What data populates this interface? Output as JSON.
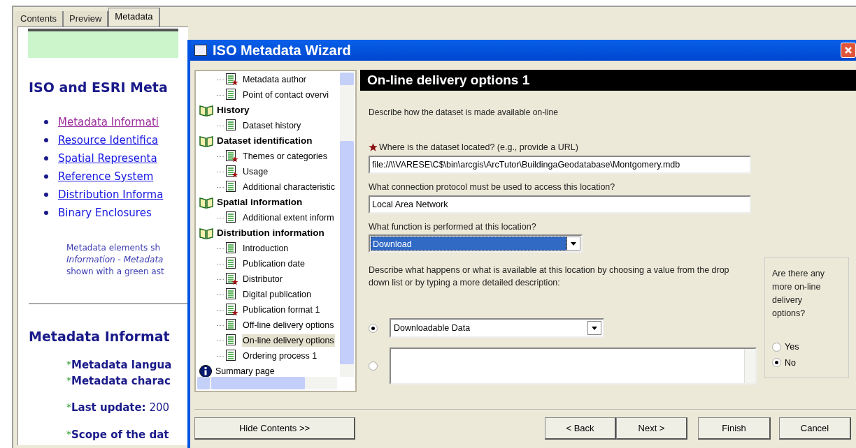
{
  "tabs": [
    {
      "label": "Contents",
      "selected": false
    },
    {
      "label": "Preview",
      "selected": false
    },
    {
      "label": "Metadata",
      "selected": true
    }
  ],
  "page": {
    "heading": "ISO and ESRI Meta",
    "links": [
      {
        "label": "Metadata Informati",
        "visited": true,
        "kind": "link"
      },
      {
        "label": "Resource Identifica",
        "visited": false,
        "kind": "link"
      },
      {
        "label": "Spatial Representa",
        "visited": false,
        "kind": "link"
      },
      {
        "label": "Reference System",
        "visited": false,
        "kind": "link"
      },
      {
        "label": "Distribution Informa",
        "visited": false,
        "kind": "link"
      },
      {
        "label": "Binary Enclosures",
        "visited": false,
        "kind": "plain"
      }
    ],
    "note_lines": [
      "Metadata elements sh",
      "*Information - Metadata*",
      "shown with a green ast"
    ],
    "section_heading": "Metadata Informat",
    "section_items": [
      {
        "marker": "*",
        "label": "**Metadata langua**"
      },
      {
        "marker": "*",
        "label": "**Metadata charac**"
      },
      {
        "marker": "*",
        "label": "**Last update:** 200"
      },
      {
        "marker": "*",
        "label": "**Scope of the dat**"
      }
    ]
  },
  "wizard": {
    "title": "ISO Metadata Wizard",
    "tree": [
      {
        "kind": "page",
        "label": "Metadata author",
        "required": true,
        "selected": false
      },
      {
        "kind": "page",
        "label": "Point of contact overvi",
        "required": false,
        "selected": false
      },
      {
        "kind": "group",
        "label": "History",
        "children": [
          {
            "kind": "page",
            "label": "Dataset history",
            "required": false,
            "selected": false
          }
        ]
      },
      {
        "kind": "group",
        "label": "Dataset identification",
        "children": [
          {
            "kind": "page",
            "label": "Themes or categories",
            "required": true,
            "selected": false
          },
          {
            "kind": "page",
            "label": "Usage",
            "required": true,
            "selected": false
          },
          {
            "kind": "page",
            "label": "Additional characteristic",
            "required": false,
            "selected": false
          }
        ]
      },
      {
        "kind": "group",
        "label": "Spatial information",
        "children": [
          {
            "kind": "page",
            "label": "Additional extent inform",
            "required": false,
            "selected": false
          }
        ]
      },
      {
        "kind": "group",
        "label": "Distribution information",
        "children": [
          {
            "kind": "page",
            "label": "Introduction",
            "required": false,
            "selected": false
          },
          {
            "kind": "page",
            "label": "Publication date",
            "required": false,
            "selected": false
          },
          {
            "kind": "page",
            "label": "Distributor",
            "required": true,
            "selected": false
          },
          {
            "kind": "page",
            "label": "Digital publication",
            "required": false,
            "selected": false
          },
          {
            "kind": "page",
            "label": "Publication format 1",
            "required": true,
            "selected": false
          },
          {
            "kind": "page",
            "label": "Off-line delivery options",
            "required": false,
            "selected": false
          },
          {
            "kind": "page",
            "label": "On-line delivery options",
            "required": false,
            "selected": true
          },
          {
            "kind": "page",
            "label": "Ordering process 1",
            "required": false,
            "selected": false
          }
        ]
      },
      {
        "kind": "summary",
        "label": "Summary page"
      }
    ],
    "heading": "On-line delivery options 1",
    "intro": "Describe how the dataset is made available on-line",
    "fields": [
      {
        "kind": "text",
        "label": "Where is the dataset located? (e.g., provide a URL)",
        "required": true,
        "value": "file://\\\\VARESE\\C$\\bin\\arcgis\\ArcTutor\\BuildingaGeodatabase\\Montgomery.mdb"
      },
      {
        "kind": "text",
        "label": "What connection protocol must be used to access this location?",
        "required": false,
        "value": "Local Area Network"
      },
      {
        "kind": "dropdown",
        "label": "What function is performed at this location?",
        "required": false,
        "value": "Download",
        "focused": true
      }
    ],
    "description_prompt": "Describe what happens or what is available at this location by choosing a value from the drop down list or by typing a more detailed description:",
    "description_options": [
      {
        "kind": "dropdown",
        "value": "Downloadable Data",
        "selected": true
      },
      {
        "kind": "textarea",
        "selected": false
      }
    ],
    "more_question": "Are there any more on-line delivery options?",
    "more_options": [
      {
        "label": "Yes",
        "selected": false
      },
      {
        "label": "No",
        "selected": true
      }
    ],
    "buttons": [
      {
        "kind": "hide",
        "label": "Hide Contents >>"
      },
      {
        "kind": "back",
        "label": "< Back"
      },
      {
        "kind": "next",
        "label": "Next >"
      },
      {
        "kind": "finish",
        "label": "Finish"
      },
      {
        "kind": "cancel",
        "label": "Cancel"
      }
    ]
  }
}
